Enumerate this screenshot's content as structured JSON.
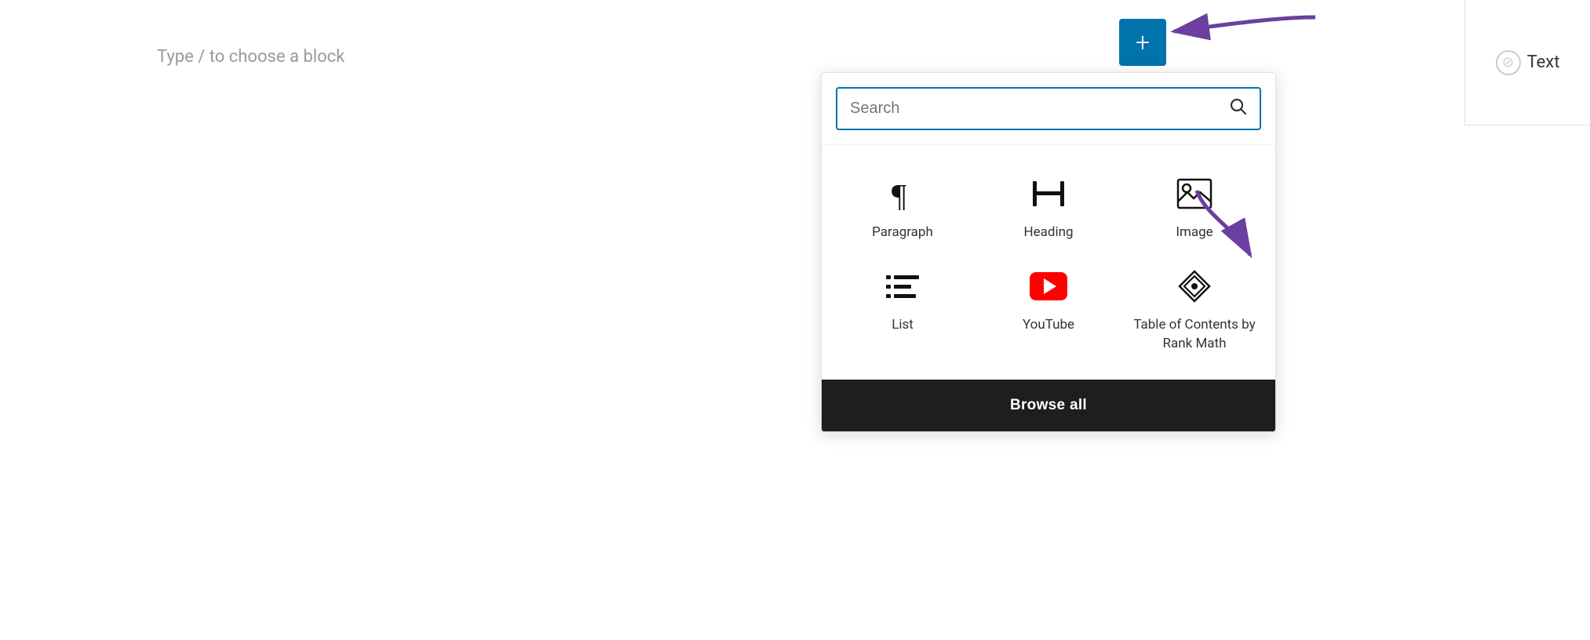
{
  "editor": {
    "placeholder": "Type / to choose a block"
  },
  "toolbar": {
    "plus_label": "+",
    "text_label": "Text"
  },
  "search": {
    "placeholder": "Search",
    "icon": "🔍"
  },
  "blocks": [
    {
      "id": "paragraph",
      "label": "Paragraph",
      "icon_type": "paragraph"
    },
    {
      "id": "heading",
      "label": "Heading",
      "icon_type": "heading"
    },
    {
      "id": "image",
      "label": "Image",
      "icon_type": "image"
    },
    {
      "id": "list",
      "label": "List",
      "icon_type": "list"
    },
    {
      "id": "youtube",
      "label": "YouTube",
      "icon_type": "youtube"
    },
    {
      "id": "toc",
      "label": "Table of Contents by Rank Math",
      "icon_type": "toc"
    }
  ],
  "footer": {
    "browse_all_label": "Browse all"
  },
  "colors": {
    "plus_bg": "#0073aa",
    "search_border": "#0073aa",
    "youtube_red": "#ff0000",
    "browse_all_bg": "#1e1e1e",
    "arrow_purple": "#6b3fa0"
  }
}
